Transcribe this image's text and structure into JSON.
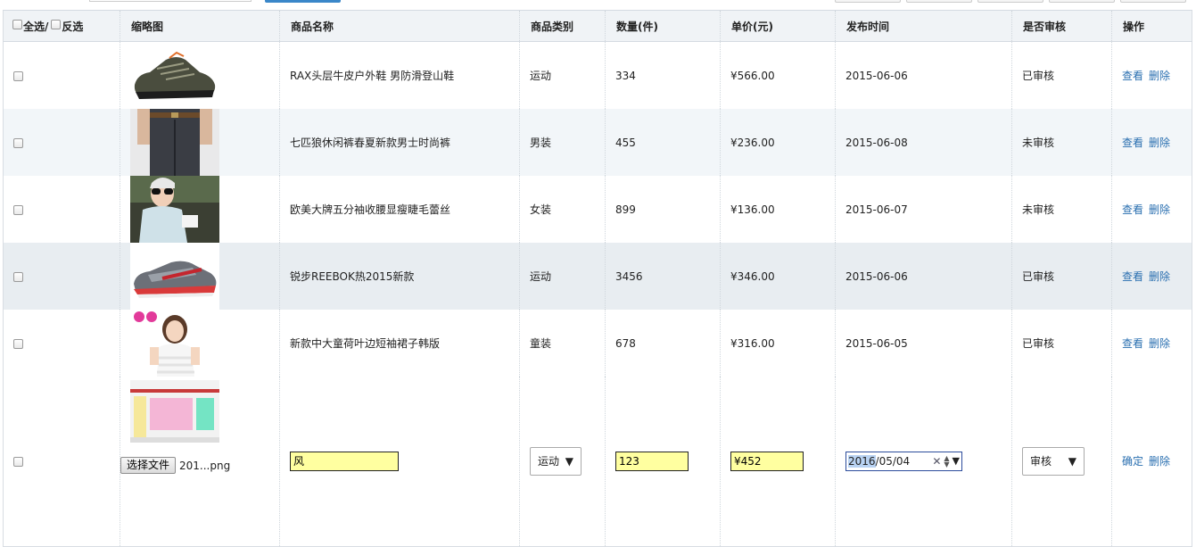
{
  "header": {
    "select_all": "全选/",
    "invert": "反选",
    "thumbnail": "缩略图",
    "name": "商品名称",
    "category": "商品类别",
    "quantity": "数量(件)",
    "price": "单价(元)",
    "date": "发布时间",
    "audit": "是否审核",
    "action": "操作"
  },
  "actions": {
    "view": "查看",
    "delete": "删除",
    "confirm": "确定"
  },
  "rows": [
    {
      "image": "hiking-shoe-image",
      "name": "RAX头层牛皮户外鞋 男防滑登山鞋",
      "category": "运动",
      "quantity": "334",
      "price": "¥566.00",
      "date": "2015-06-06",
      "audit": "已审核"
    },
    {
      "image": "mens-pants-image",
      "name": "七匹狼休闲裤春夏新款男士时尚裤",
      "category": "男装",
      "quantity": "455",
      "price": "¥236.00",
      "date": "2015-06-08",
      "audit": "未审核"
    },
    {
      "image": "lace-top-image",
      "name": "欧美大牌五分袖收腰显瘦睫毛蕾丝",
      "category": "女装",
      "quantity": "899",
      "price": "¥136.00",
      "date": "2015-06-07",
      "audit": "未审核"
    },
    {
      "image": "reebok-sneaker-image",
      "name": "锐步REEBOK热2015新款",
      "category": "运动",
      "quantity": "3456",
      "price": "¥346.00",
      "date": "2015-06-06",
      "audit": "已审核"
    },
    {
      "image": "girl-dress-image",
      "name": "新款中大童荷叶边短袖裙子韩版",
      "category": "童装",
      "quantity": "678",
      "price": "¥316.00",
      "date": "2015-06-05",
      "audit": "已审核"
    }
  ],
  "edit_row": {
    "name_value": "风",
    "category_value": "运动",
    "quantity_value": "123",
    "price_value": "¥452",
    "date_year": "2016",
    "date_rest": "/05/04",
    "audit_value": "审核",
    "file_button": "选择文件",
    "file_name": "201...png"
  },
  "colors": {
    "link": "#2a6fb0",
    "input_bg": "#ffffa0",
    "header_bg": "#f0f3f6"
  }
}
